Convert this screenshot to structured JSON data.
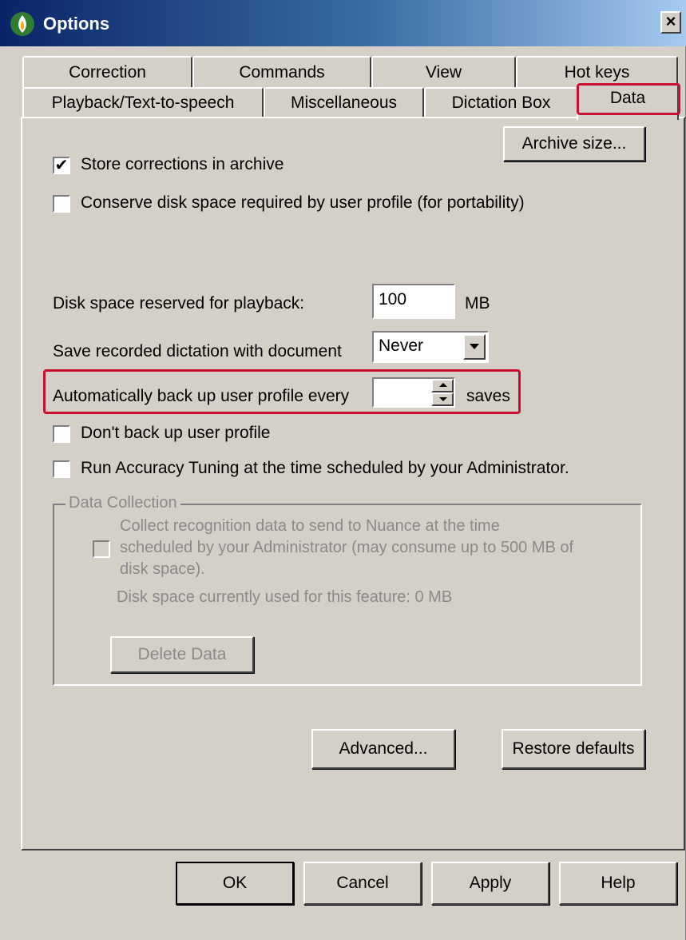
{
  "window": {
    "title": "Options",
    "close_glyph": "×",
    "icon": "app-flame-icon"
  },
  "tabs": {
    "row1": [
      "Correction",
      "Commands",
      "View",
      "Hot keys"
    ],
    "row2": [
      "Playback/Text-to-speech",
      "Miscellaneous",
      "Dictation Box",
      "Data"
    ],
    "active": "Data"
  },
  "data_tab": {
    "store_corrections": {
      "label": "Store corrections in archive",
      "checked": true
    },
    "archive_size_button": "Archive size...",
    "conserve_disk": {
      "label": "Conserve disk space required by user profile (for portability)",
      "checked": false
    },
    "disk_space_label": "Disk space reserved for playback:",
    "disk_space_value": "100",
    "disk_space_unit": "MB",
    "save_recorded_label": "Save recorded dictation with document",
    "save_recorded_value": "Never",
    "auto_backup_label": "Automatically back up user profile every",
    "auto_backup_value": "",
    "auto_backup_unit": "saves",
    "dont_backup": {
      "label": "Don't back up user profile",
      "checked": false
    },
    "run_accuracy": {
      "label": "Run Accuracy Tuning at the time scheduled by your Administrator.",
      "checked": false
    },
    "data_collection": {
      "legend": "Data Collection",
      "collect_label_line1": "Collect recognition data to send to Nuance at the time",
      "collect_label_line2": "scheduled by your Administrator (may consume up to 500 MB of",
      "collect_label_line3": "disk space).",
      "disk_used": "Disk space currently used for this feature: 0 MB",
      "delete_button": "Delete Data"
    },
    "advanced_button": "Advanced...",
    "restore_defaults_button": "Restore defaults"
  },
  "footer": {
    "ok": "OK",
    "cancel": "Cancel",
    "apply": "Apply",
    "help": "Help"
  },
  "colors": {
    "highlight": "#c8102e",
    "face": "#d4d0c8",
    "title_gradient_start": "#0a2468"
  }
}
